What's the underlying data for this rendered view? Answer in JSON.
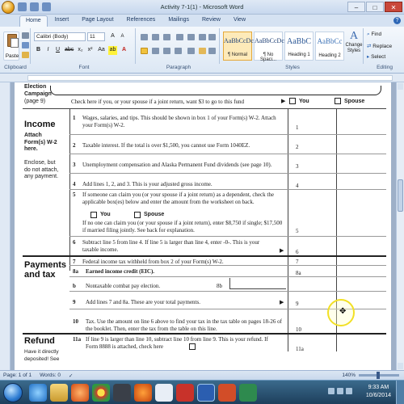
{
  "window": {
    "title": "Activity 7-1(1) - Microsoft Word",
    "controls": [
      "–",
      "□",
      "✕"
    ]
  },
  "tabs": [
    "Home",
    "Insert",
    "Page Layout",
    "References",
    "Mailings",
    "Review",
    "View"
  ],
  "ribbon": {
    "clipboard": {
      "paste": "Paste",
      "group": "Clipboard"
    },
    "font": {
      "family": "Calibri (Body)",
      "size": "11",
      "group": "Font"
    },
    "paragraph": {
      "group": "Paragraph"
    },
    "styles": {
      "group": "Styles",
      "items": [
        {
          "preview": "AaBbCcDc",
          "name": "¶ Normal"
        },
        {
          "preview": "AaBbCcDc",
          "name": "¶ No Spaci..."
        },
        {
          "preview": "AaBbC",
          "name": "Heading 1"
        },
        {
          "preview": "AaBbCc",
          "name": "Heading 2"
        }
      ],
      "change_styles": "Change Styles"
    },
    "editing": {
      "group": "Editing",
      "find": "Find",
      "replace": "Replace",
      "select": "Select"
    }
  },
  "form": {
    "election": {
      "title": "Election Campaign",
      "page": "(page 9)",
      "text": "Check here if you, or your spouse if a joint return, want $3 to go to this fund",
      "you": "You",
      "spouse": "Spouse"
    },
    "income": {
      "title": "Income",
      "note1": "Attach Form(s) W-2 here.",
      "note2": "Enclose, but do not attach, any payment.",
      "lines": [
        {
          "num": "1",
          "text": "Wages, salaries, and tips. This should be shown in box 1 of your Form(s) W-2. Attach your Form(s) W-2.",
          "ref": "1"
        },
        {
          "num": "2",
          "text": "Taxable interest. If the total is over $1,500, you cannot use Form 1040EZ.",
          "ref": "2"
        },
        {
          "num": "3",
          "text": "Unemployment compensation and Alaska Permanent Fund dividends (see page 10).",
          "ref": "3"
        },
        {
          "num": "4",
          "text": "Add lines 1, 2, and 3. This is your adjusted gross income.",
          "ref": "4"
        },
        {
          "num": "5",
          "text": "If someone can claim you (or your spouse if a joint return) as a dependent, check the applicable box(es) below and enter the amount from the worksheet on back.",
          "ref": "5"
        },
        {
          "num": "6",
          "text": "Subtract line 5 from line 4. If line 5 is larger than line 4, enter -0-. This is your taxable income.",
          "ref": "6"
        }
      ],
      "dep_you": "You",
      "dep_spouse": "Spouse",
      "line5_extra": "If no one can claim you (or your spouse if a joint return), enter $8,750 if single; $17,500 if married filing jointly. See back for explanation."
    },
    "payments": {
      "title": "Payments and tax",
      "lines": [
        {
          "num": "7",
          "text": "Federal income tax withheld from box 2 of your Form(s) W-2.",
          "ref": "7"
        },
        {
          "num": "8a",
          "text": "Earned income credit (EIC).",
          "ref": "8a"
        },
        {
          "num": "b",
          "text": "Nontaxable combat pay election.",
          "ref": "8b"
        },
        {
          "num": "9",
          "text": "Add lines 7 and 8a. These are your total payments.",
          "ref": "9"
        },
        {
          "num": "10",
          "text": "Tax. Use the amount on line 6 above to find your tax in the tax table on pages 18-26 of the booklet. Then, enter the tax from the table on this line.",
          "ref": "10"
        }
      ]
    },
    "refund": {
      "title": "Refund",
      "note": "Have it directly deposited! See",
      "line": {
        "num": "11a",
        "text": "If line 9 is larger than line 10, subtract line 10 from line 9. This is your refund. If Form 8888 is attached, check here",
        "ref": "11a"
      }
    }
  },
  "status": {
    "page": "Page: 1 of 1",
    "words": "Words: 0",
    "zoom": "140%"
  },
  "taskbar": {
    "time": "9:33 AM",
    "date": "10/6/2014"
  },
  "colors": {
    "accent": "#2d67b6",
    "ribbon_bg": "#dce7f4",
    "taskbar_bg": "#1d3f5c"
  }
}
